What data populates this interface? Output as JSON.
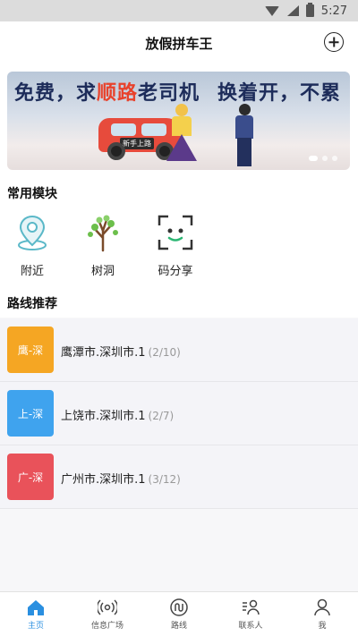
{
  "status_bar": {
    "time": "5:27"
  },
  "header": {
    "title": "放假拼车王"
  },
  "banner": {
    "slogan_left_a": "免费，求",
    "slogan_left_highlight": "顺路",
    "slogan_left_b": "老司机",
    "slogan_right": "换着开，不累",
    "car_tag": "新手上路"
  },
  "modules": {
    "title": "常用模块",
    "items": [
      {
        "label": "附近",
        "icon": "location-pin-icon"
      },
      {
        "label": "树洞",
        "icon": "tree-icon"
      },
      {
        "label": "码分享",
        "icon": "scan-code-icon"
      }
    ]
  },
  "routes": {
    "title": "路线推荐",
    "items": [
      {
        "badge": "鹰-深",
        "name": "鹰潭市.深圳市.1",
        "count": "(2/10)",
        "color": "#f5a623"
      },
      {
        "badge": "上-深",
        "name": "上饶市.深圳市.1",
        "count": "(2/7)",
        "color": "#3fa3ee"
      },
      {
        "badge": "广-深",
        "name": "广州市.深圳市.1",
        "count": "(3/12)",
        "color": "#e9525a"
      }
    ]
  },
  "tabbar": {
    "items": [
      {
        "label": "主页",
        "icon": "home-icon",
        "active": true
      },
      {
        "label": "信息广场",
        "icon": "broadcast-icon"
      },
      {
        "label": "路线",
        "icon": "route-icon"
      },
      {
        "label": "联系人",
        "icon": "contacts-icon"
      },
      {
        "label": "我",
        "icon": "user-icon"
      }
    ]
  },
  "colors": {
    "accent": "#2a8fe0",
    "banner_highlight": "#e8422c"
  }
}
